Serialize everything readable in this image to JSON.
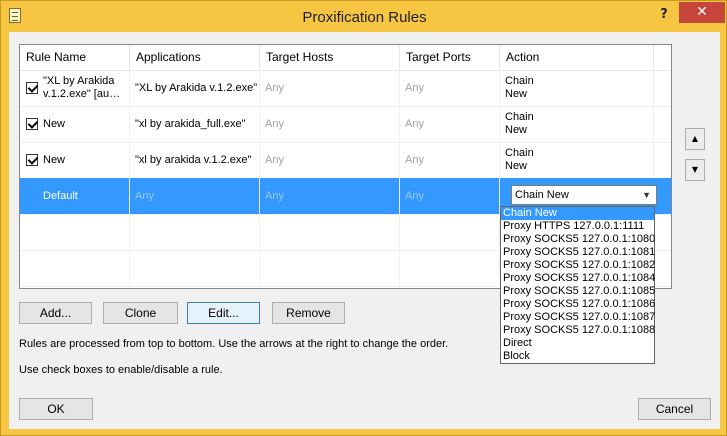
{
  "window": {
    "title": "Proxification Rules",
    "help": "?",
    "close": "✕"
  },
  "table": {
    "columns": [
      "Rule Name",
      "Applications",
      "Target Hosts",
      "Target Ports",
      "Action"
    ],
    "rows": [
      {
        "checked": true,
        "name": "\"XL by Arakida v.1.2.exe\" [au…",
        "apps": "\"XL by Arakida v.1.2.exe\"",
        "hosts": "Any",
        "ports": "Any",
        "action": "Chain New"
      },
      {
        "checked": true,
        "name": "New",
        "apps": "\"xl by arakida_full.exe\"",
        "hosts": "Any",
        "ports": "Any",
        "action": "Chain New"
      },
      {
        "checked": true,
        "name": "New",
        "apps": "\"xl by arakida v.1.2.exe\"",
        "hosts": "Any",
        "ports": "Any",
        "action": "Chain New"
      }
    ],
    "default_row": {
      "name": "Default",
      "apps": "Any",
      "hosts": "Any",
      "ports": "Any",
      "action_selected": "Chain New"
    }
  },
  "dropdown_options": [
    "Chain New",
    "Proxy HTTPS 127.0.0.1:1111",
    "Proxy SOCKS5 127.0.0.1:1080",
    "Proxy SOCKS5 127.0.0.1:1081",
    "Proxy SOCKS5 127.0.0.1:1082",
    "Proxy SOCKS5 127.0.0.1:1084",
    "Proxy SOCKS5 127.0.0.1:1085",
    "Proxy SOCKS5 127.0.0.1:1086",
    "Proxy SOCKS5 127.0.0.1:1087",
    "Proxy SOCKS5 127.0.0.1:1088",
    "Direct",
    "Block"
  ],
  "highlighted_option": "Chain New",
  "buttons": {
    "add": "Add...",
    "clone": "Clone",
    "edit": "Edit...",
    "remove": "Remove",
    "ok": "OK",
    "cancel": "Cancel",
    "up": "▲",
    "down": "▼"
  },
  "notes": {
    "order": "Rules are processed from top to bottom. Use the arrows at the right to change the order.",
    "checkbox": "Use check boxes to enable/disable a rule."
  },
  "colors": {
    "frame": "#f6c542",
    "close": "#c7463b",
    "selection": "#3399ff"
  }
}
